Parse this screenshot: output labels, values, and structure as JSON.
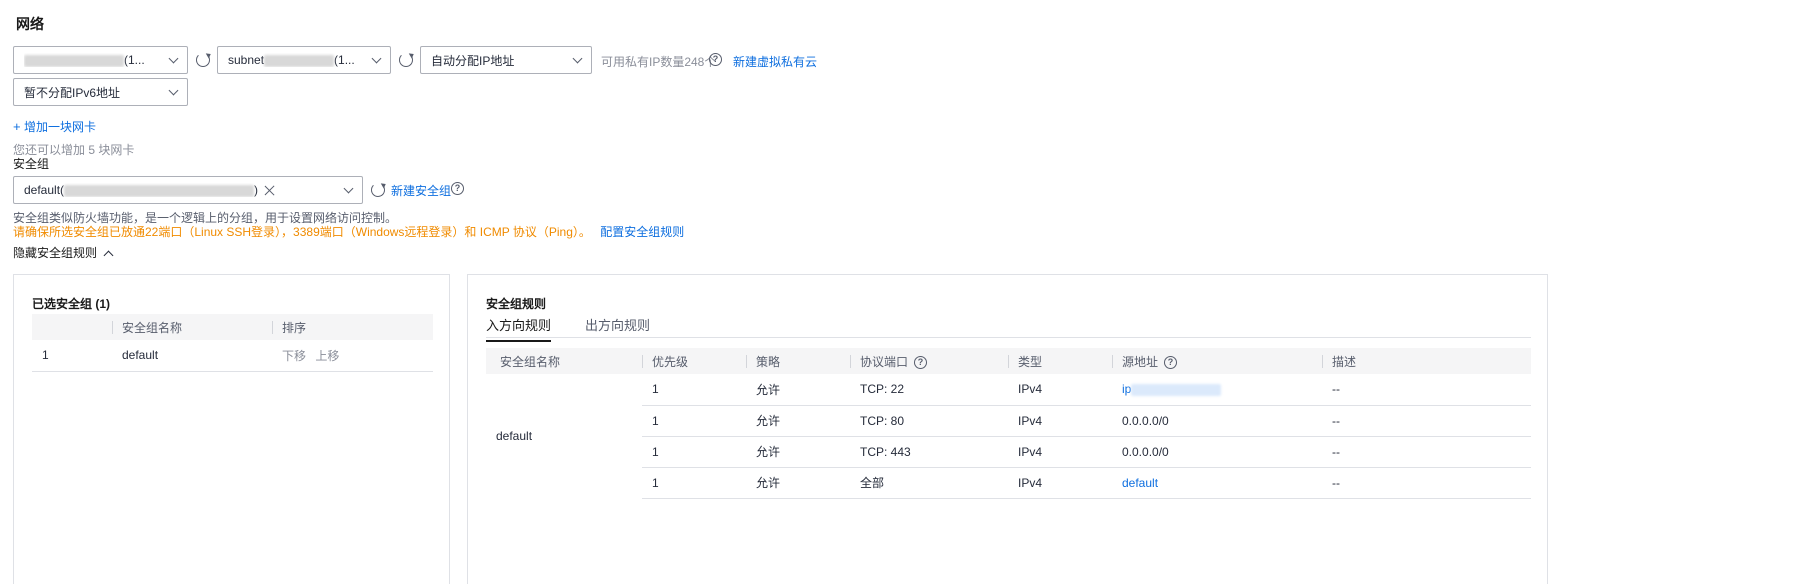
{
  "section": {
    "title": "网络"
  },
  "network": {
    "vpc_select": {
      "value_suffix": "(1..."
    },
    "subnet_select": {
      "value_prefix": "subnet",
      "value_suffix": "(1..."
    },
    "ip_select": {
      "value": "自动分配IP地址"
    },
    "ip_count_text": "可用私有IP数量248个",
    "new_vpc_link": "新建虚拟私有云",
    "ipv6_select": {
      "value": "暂不分配IPv6地址"
    },
    "add_nic_link": "增加一块网卡",
    "add_nic_hint": "您还可以增加 5 块网卡"
  },
  "security_group": {
    "label": "安全组",
    "selected_prefix": "default(",
    "selected_suffix": ")",
    "new_sg_link": "新建安全组",
    "desc": "安全组类似防火墙功能，是一个逻辑上的分组，用于设置网络访问控制。",
    "warning": "请确保所选安全组已放通22端口（Linux SSH登录），3389端口（Windows远程登录）和 ICMP 协议（Ping）。",
    "config_link": "配置安全组规则",
    "toggle_label": "隐藏安全组规则"
  },
  "selected_panel": {
    "title": "已选安全组 (1)",
    "headers": [
      "安全组名称",
      "排序"
    ],
    "rows": [
      {
        "index": "1",
        "name": "default",
        "down": "下移",
        "up": "上移"
      }
    ]
  },
  "rules_panel": {
    "title": "安全组规则",
    "tabs": [
      "入方向规则",
      "出方向规则"
    ],
    "headers": [
      "安全组名称",
      "优先级",
      "策略",
      "协议端口",
      "类型",
      "源地址",
      "描述"
    ],
    "group_name": "default",
    "rows": [
      {
        "priority": "1",
        "policy": "允许",
        "port": "TCP: 22",
        "type": "IPv4",
        "source": "ip",
        "source_link": true,
        "desc": "--"
      },
      {
        "priority": "1",
        "policy": "允许",
        "port": "TCP: 80",
        "type": "IPv4",
        "source": "0.0.0.0/0",
        "source_link": false,
        "desc": "--"
      },
      {
        "priority": "1",
        "policy": "允许",
        "port": "TCP: 443",
        "type": "IPv4",
        "source": "0.0.0.0/0",
        "source_link": false,
        "desc": "--"
      },
      {
        "priority": "1",
        "policy": "允许",
        "port": "全部",
        "type": "IPv4",
        "source": "default",
        "source_link": true,
        "desc": "--"
      }
    ]
  },
  "icons": {
    "refresh": "refresh-icon",
    "help": "help-circle-icon",
    "chevron": "chevron-down-icon",
    "plus": "plus-icon",
    "close": "close-icon"
  }
}
